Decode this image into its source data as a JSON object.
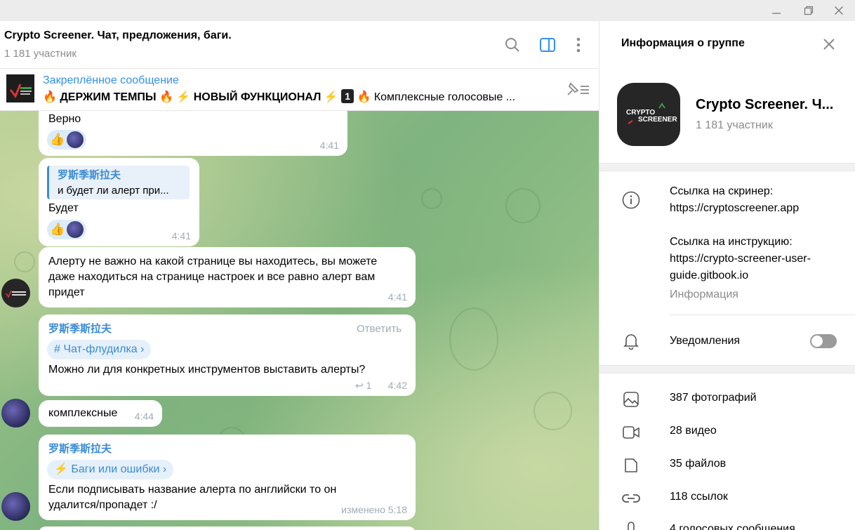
{
  "window": {
    "minimize_icon": "minimize-icon",
    "restore_icon": "restore-icon",
    "close_icon": "close-icon"
  },
  "chat": {
    "title": "Crypto Screener. Чат, предложения, баги.",
    "members": "1 181 участник",
    "icons": [
      "search-icon",
      "sidebar-toggle-icon",
      "more-vert-icon"
    ],
    "accent_color": "#3390ec"
  },
  "pinned": {
    "label": "Закреплённое сообщение",
    "text_bold": "🔥 ДЕРЖИМ ТЕМПЫ 🔥 ⚡ НОВЫЙ ФУНКЦИОНАЛ ⚡",
    "num": "1",
    "text_rest": "🔥 Комплексные голосовые ..."
  },
  "messages": [
    {
      "text": "Верно",
      "time": "4:41",
      "reaction": "👍"
    },
    {
      "quote_author": "罗斯季斯拉夫",
      "quote_text": "и будет ли алерт при...",
      "text": "Будет",
      "time": "4:41",
      "reaction": "👍"
    },
    {
      "text": "Алерту не важно на какой странице вы находитесь, вы можете даже находиться на странице настроек и все равно алерт вам придет",
      "time": "4:41"
    },
    {
      "author": "罗斯季斯拉夫",
      "reply_label": "Ответить",
      "topic": "# Чат-флудилка ›",
      "text": "Можно ли для конкретных инструментов выставить алерты?",
      "replies": "1",
      "time": "4:42"
    },
    {
      "text": "комплексные",
      "time": "4:44"
    },
    {
      "author": "罗斯季斯拉夫",
      "topic": "⚡ Баги или ошибки ›",
      "text": "Если подписывать название алерта по английски то он удалится/пропадет  :/",
      "time": "изменено 5:18"
    }
  ],
  "panel": {
    "title": "Информация о группе",
    "name": "Crypto Screener. Ч...",
    "members": "1 181 участник",
    "logo_text_1": "CRYPTO",
    "logo_text_2": "SCREENER",
    "info_line_1": "Ссылка на скринер:",
    "info_line_2": "https://cryptoscreener.app",
    "info_line_3": "Ссылка на инструкцию:",
    "info_line_4": "https://crypto-screener-user-",
    "info_line_5": "guide.gitbook.io",
    "info_caption": "Информация",
    "notifications": "Уведомления",
    "notifications_on": false,
    "media": {
      "photos": "387 фотографий",
      "videos": "28 видео",
      "files": "35 файлов",
      "links": "118 ссылок",
      "voice": "4 голосовых сообщения"
    }
  }
}
